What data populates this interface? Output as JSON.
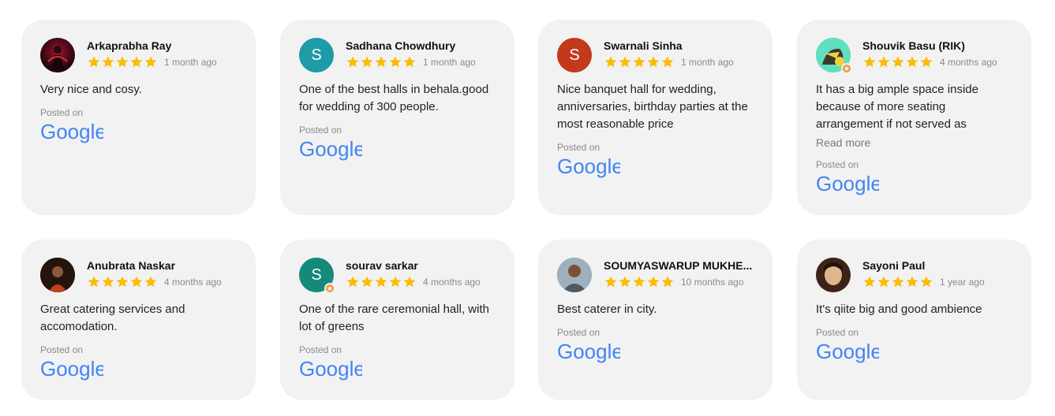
{
  "posted_label": "Posted on",
  "google_word": "Google",
  "read_more": "Read more",
  "colors": {
    "card_bg": "#f2f2f2",
    "star": "#fbbc04",
    "google_blue": "#4285f4"
  },
  "reviews": [
    {
      "name": "Arkaprabha Ray",
      "time": "1 month ago",
      "rating": 5,
      "text": "Very nice and cosy.",
      "avatar_icon": "avatar-photo-icon"
    },
    {
      "name": "Sadhana Chowdhury",
      "time": "1 month ago",
      "rating": 5,
      "text": "One of the best halls in behala.good for wedding of 300 people.",
      "avatar_letter": "S"
    },
    {
      "name": "Swarnali Sinha",
      "time": "1 month ago",
      "rating": 5,
      "text": "Nice banquet hall for wedding, anniversaries, birthday parties at the most reasonable price",
      "avatar_letter": "S"
    },
    {
      "name": "Shouvik Basu (RIK)",
      "time": "4 months ago",
      "rating": 5,
      "text": "It has a big ample space inside because of more seating arrangement if not served as",
      "avatar_icon": "avatar-photo-icon"
    },
    {
      "name": "Anubrata Naskar",
      "time": "4 months ago",
      "rating": 5,
      "text": "Great catering services and accomodation.",
      "avatar_icon": "avatar-photo-icon"
    },
    {
      "name": "sourav sarkar",
      "time": "4 months ago",
      "rating": 5,
      "text": "One of the rare ceremonial hall, with lot of greens",
      "avatar_letter": "S"
    },
    {
      "name": "SOUMYASWARUP MUKHE...",
      "time": "10 months ago",
      "rating": 5,
      "text": "Best caterer in city.",
      "avatar_icon": "avatar-photo-icon"
    },
    {
      "name": "Sayoni Paul",
      "time": "1 year ago",
      "rating": 5,
      "text": "It's qiite big and good ambience",
      "avatar_icon": "avatar-photo-icon"
    }
  ]
}
